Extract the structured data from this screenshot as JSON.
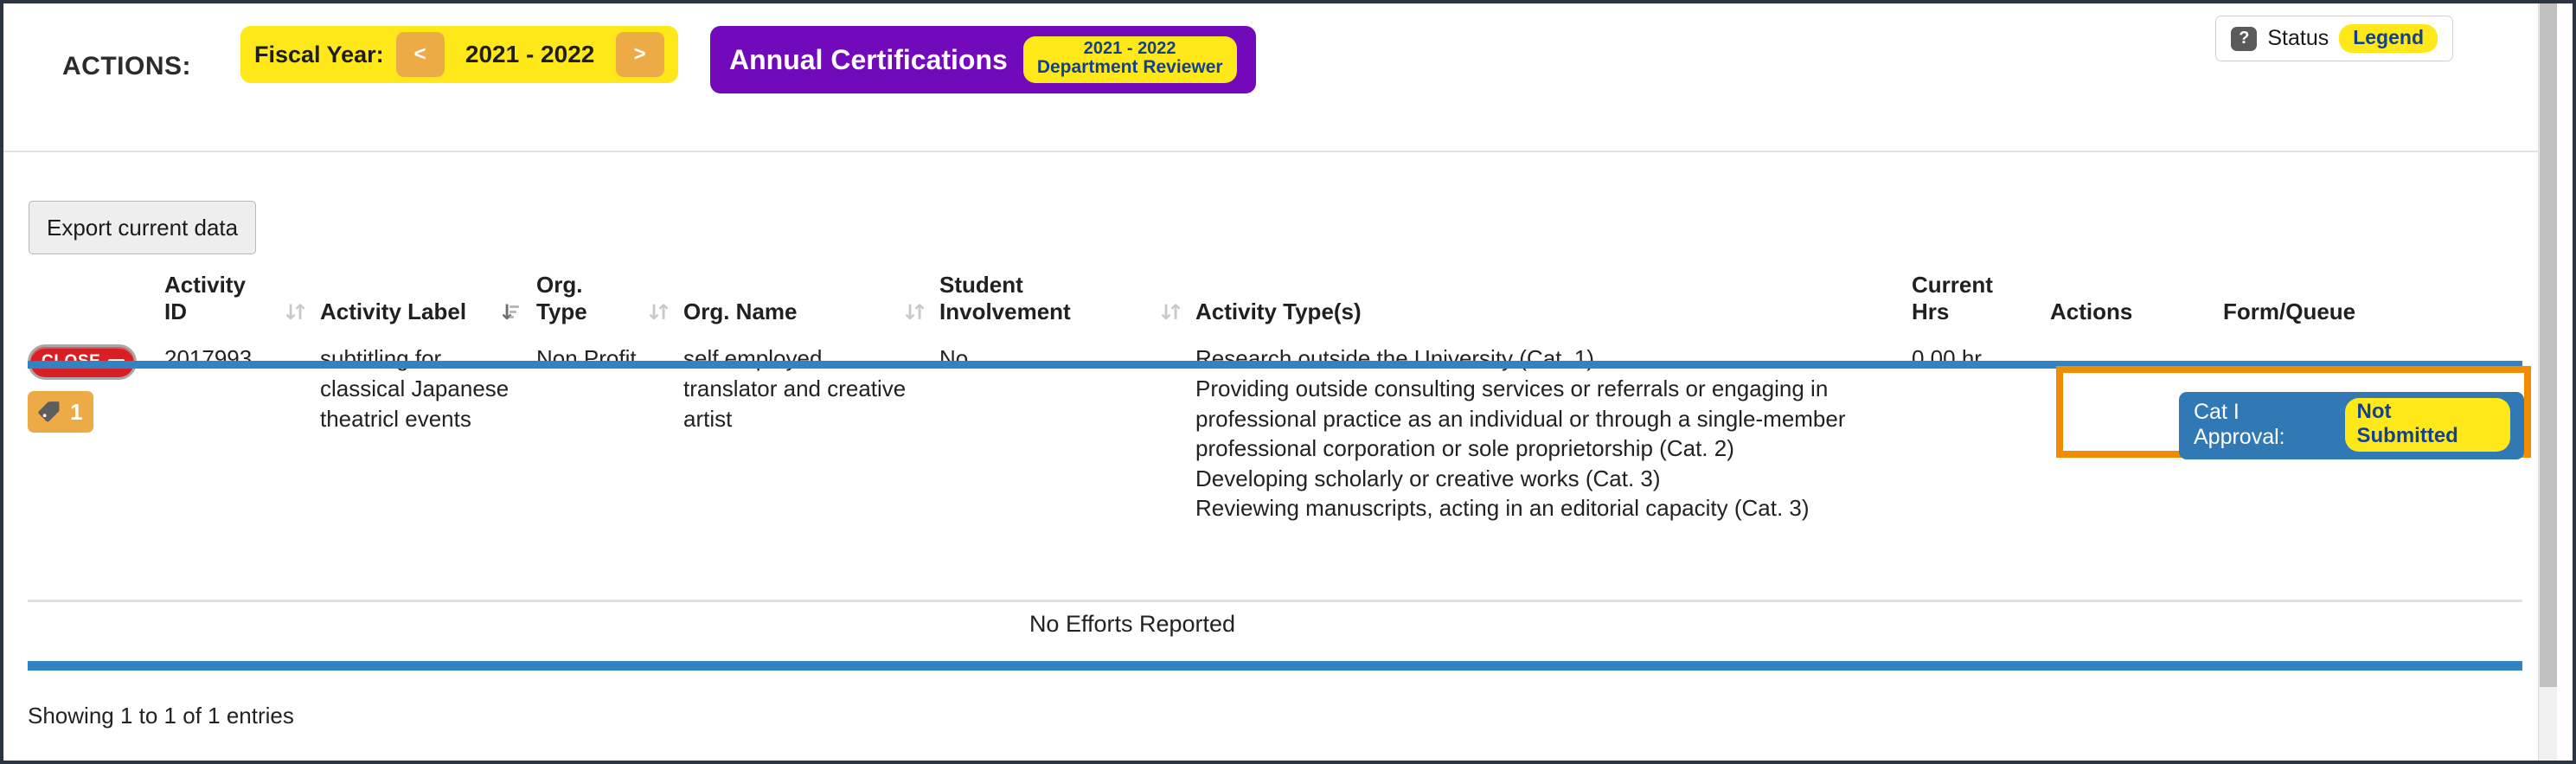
{
  "toolbar": {
    "actions_label": "ACTIONS:",
    "fiscal_year_label": "Fiscal Year:",
    "fiscal_year_value": "2021 - 2022",
    "prev_arrow": "<",
    "next_arrow": ">",
    "certifications_title": "Annual Certifications",
    "certifications_year": "2021 - 2022",
    "certifications_role": "Department Reviewer",
    "status_help_icon": "?",
    "status_label": "Status",
    "legend_label": "Legend"
  },
  "table_controls": {
    "export_label": "Export current data"
  },
  "table": {
    "columns": [
      {
        "label": "",
        "sort": "none"
      },
      {
        "label_line1": "Activity",
        "label_line2": "ID",
        "sort": "unsorted"
      },
      {
        "label_line1": "",
        "label_line2": "Activity Label",
        "sort": "sorted-desc"
      },
      {
        "label_line1": "Org.",
        "label_line2": "Type",
        "sort": "unsorted"
      },
      {
        "label_line1": "",
        "label_line2": "Org. Name",
        "sort": "unsorted"
      },
      {
        "label_line1": "Student",
        "label_line2": "Involvement",
        "sort": "unsorted"
      },
      {
        "label_line1": "",
        "label_line2": "Activity Type(s)",
        "sort": "none"
      },
      {
        "label_line1": "Current",
        "label_line2": "Hrs",
        "sort": "none"
      },
      {
        "label_line1": "",
        "label_line2": "Actions",
        "sort": "none"
      },
      {
        "label_line1": "",
        "label_line2": "Form/Queue",
        "sort": "none"
      }
    ],
    "row": {
      "close_button_label": "CLOSE",
      "tag_count": "1",
      "activity_id": "2017993",
      "activity_label": "subtitling for classical Japanese theatricl events",
      "org_type": "Non Profit",
      "org_name": "self employed translator and creative artist",
      "student_involvement": "No",
      "activity_types": [
        "Research outside the University (Cat. 1)",
        "Providing outside consulting services or referrals or engaging in professional practice as an individual or through a single-member professional corporation or sole proprietorship (Cat. 2)",
        "Developing scholarly or creative works (Cat. 3)",
        "Reviewing manuscripts, acting in an editorial capacity (Cat. 3)"
      ],
      "current_hrs": "0.00 hr",
      "approval_label": "Cat I Approval:",
      "approval_status": "Not Submitted"
    },
    "no_efforts_text": "No Efforts Reported",
    "showing_text": "Showing 1 to 1 of 1 entries"
  },
  "colors": {
    "fiscal_yellow": "#ffe81a",
    "arrow_orange": "#edab45",
    "cert_purple": "#7209bb",
    "badge_blue": "#3079b5",
    "rule_blue": "#3183c4",
    "highlight_orange": "#f08c00",
    "close_red": "#d81f26",
    "link_navy": "#14418a"
  }
}
